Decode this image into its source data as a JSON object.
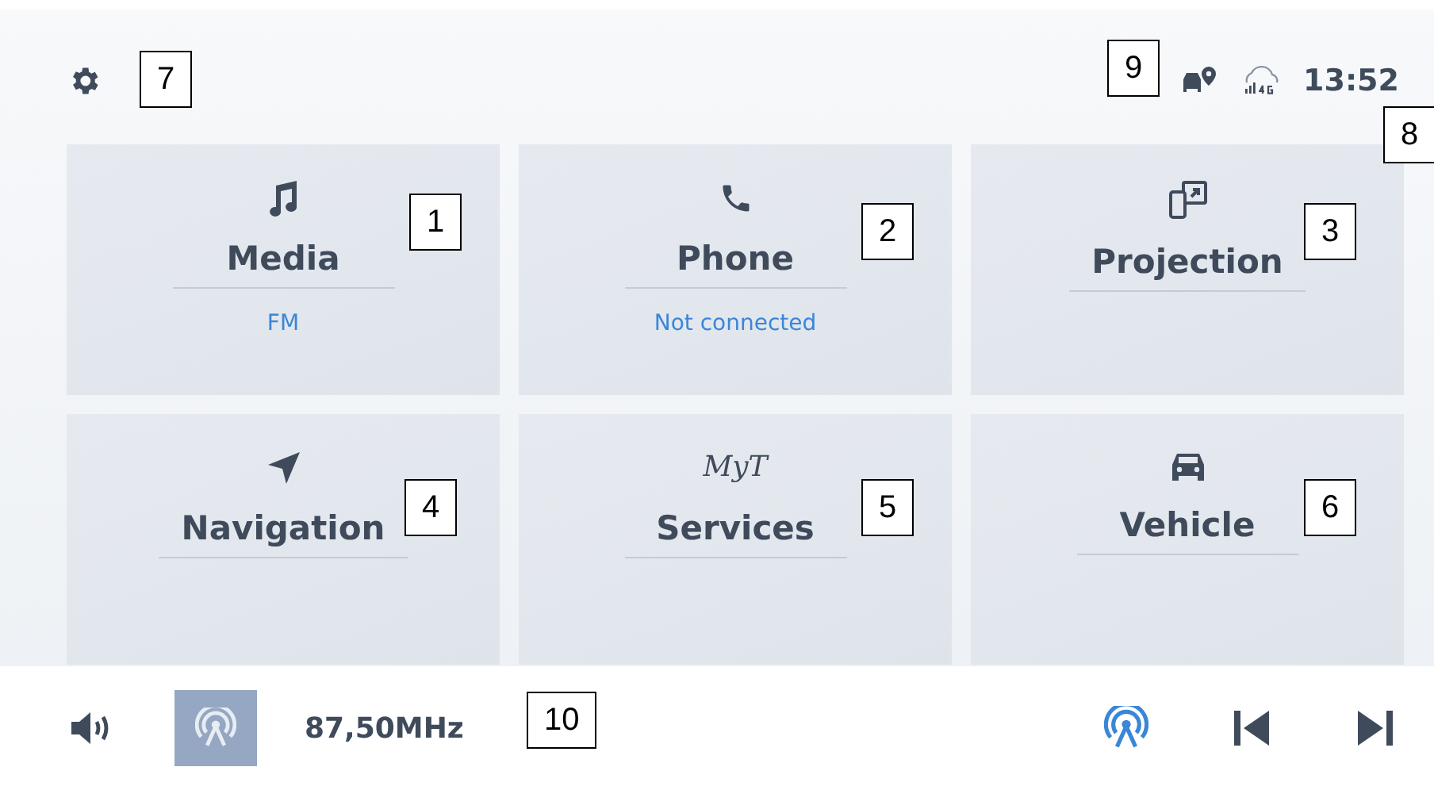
{
  "top_bar": {
    "clock": "13:52"
  },
  "tiles": [
    {
      "kind": "music",
      "title": "Media",
      "subtitle": "FM"
    },
    {
      "kind": "phone",
      "title": "Phone",
      "subtitle": "Not connected"
    },
    {
      "kind": "projection",
      "title": "Projection"
    },
    {
      "kind": "navigation",
      "title": "Navigation"
    },
    {
      "kind": "services",
      "title": "Services",
      "logo": "MyT"
    },
    {
      "kind": "vehicle",
      "title": "Vehicle"
    }
  ],
  "bottom_bar": {
    "source_selected": true,
    "frequency": "87,50MHz"
  },
  "callouts": [
    {
      "label": "1"
    },
    {
      "label": "2"
    },
    {
      "label": "3"
    },
    {
      "label": "4"
    },
    {
      "label": "5"
    },
    {
      "label": "6"
    },
    {
      "label": "7"
    },
    {
      "label": "8"
    },
    {
      "label": "9"
    },
    {
      "label": "10"
    }
  ]
}
